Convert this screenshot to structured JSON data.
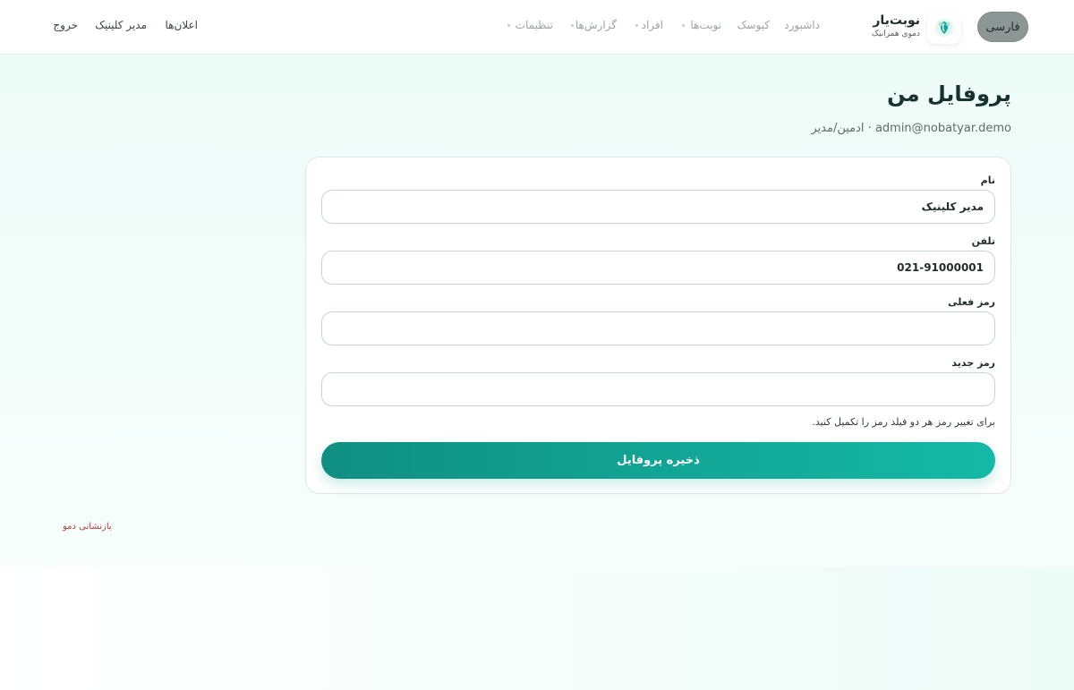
{
  "header": {
    "language_button": "فارسی",
    "brand_name": "نوبت‌یار",
    "brand_subtitle": "دموی همرانیک",
    "nav": [
      {
        "label": "داشبورد"
      },
      {
        "label": "کیوسک"
      },
      {
        "label": "نوبت‌ها"
      },
      {
        "label": "افراد"
      },
      {
        "label": "گزارش‌ها"
      },
      {
        "label": "تنظیمات"
      }
    ],
    "announcements_link": "اعلان‌ها",
    "user_name": "مدیر کلینیک",
    "logout_link": "خروج"
  },
  "page": {
    "title": "پروفایل من",
    "subtitle": "admin@nobatyar.demo · ادمین/مدیر"
  },
  "form": {
    "name_label": "نام",
    "name_value": "مدیر کلینیک",
    "phone_label": "تلفن",
    "phone_value": "021-91000001",
    "current_password_label": "رمز فعلی",
    "new_password_label": "رمز جدید",
    "hint": "برای تغییر رمز هر دو فیلد رمز را تکمیل کنید.",
    "save_button": "ذخیره پروفایل"
  },
  "footer": {
    "reset_demo": "بازنشانی دمو"
  },
  "colors": {
    "accent": "#12a594",
    "danger": "#b0413a"
  },
  "icons": {
    "logo": "leaf-shield-icon"
  }
}
